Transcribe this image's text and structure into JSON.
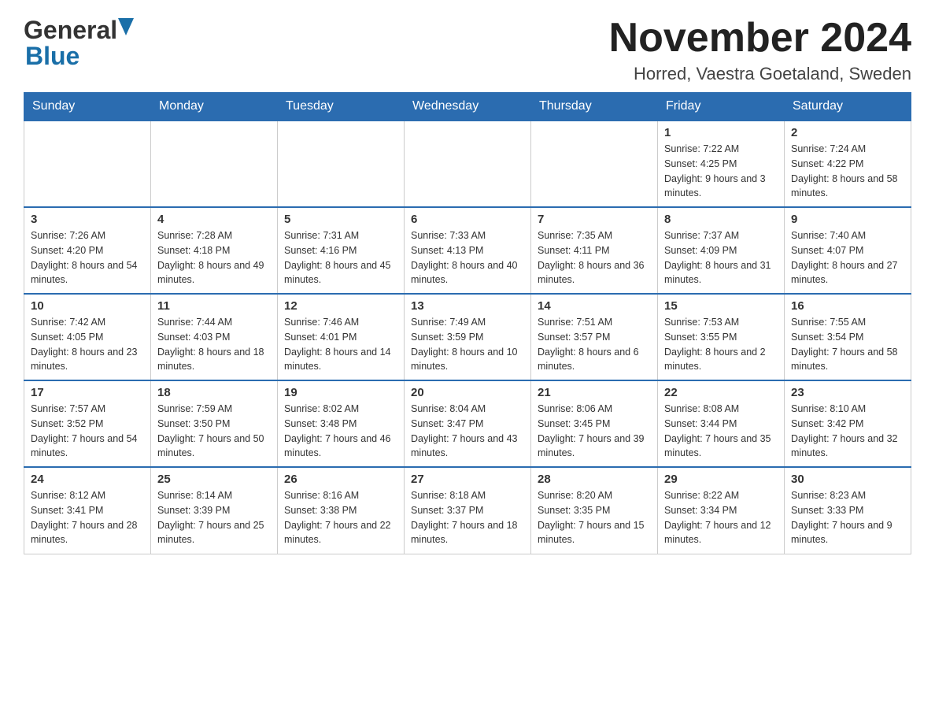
{
  "header": {
    "logo_general": "General",
    "logo_blue": "Blue",
    "month_title": "November 2024",
    "location": "Horred, Vaestra Goetaland, Sweden"
  },
  "calendar": {
    "days_of_week": [
      "Sunday",
      "Monday",
      "Tuesday",
      "Wednesday",
      "Thursday",
      "Friday",
      "Saturday"
    ],
    "weeks": [
      [
        {
          "day": "",
          "info": ""
        },
        {
          "day": "",
          "info": ""
        },
        {
          "day": "",
          "info": ""
        },
        {
          "day": "",
          "info": ""
        },
        {
          "day": "",
          "info": ""
        },
        {
          "day": "1",
          "info": "Sunrise: 7:22 AM\nSunset: 4:25 PM\nDaylight: 9 hours and 3 minutes."
        },
        {
          "day": "2",
          "info": "Sunrise: 7:24 AM\nSunset: 4:22 PM\nDaylight: 8 hours and 58 minutes."
        }
      ],
      [
        {
          "day": "3",
          "info": "Sunrise: 7:26 AM\nSunset: 4:20 PM\nDaylight: 8 hours and 54 minutes."
        },
        {
          "day": "4",
          "info": "Sunrise: 7:28 AM\nSunset: 4:18 PM\nDaylight: 8 hours and 49 minutes."
        },
        {
          "day": "5",
          "info": "Sunrise: 7:31 AM\nSunset: 4:16 PM\nDaylight: 8 hours and 45 minutes."
        },
        {
          "day": "6",
          "info": "Sunrise: 7:33 AM\nSunset: 4:13 PM\nDaylight: 8 hours and 40 minutes."
        },
        {
          "day": "7",
          "info": "Sunrise: 7:35 AM\nSunset: 4:11 PM\nDaylight: 8 hours and 36 minutes."
        },
        {
          "day": "8",
          "info": "Sunrise: 7:37 AM\nSunset: 4:09 PM\nDaylight: 8 hours and 31 minutes."
        },
        {
          "day": "9",
          "info": "Sunrise: 7:40 AM\nSunset: 4:07 PM\nDaylight: 8 hours and 27 minutes."
        }
      ],
      [
        {
          "day": "10",
          "info": "Sunrise: 7:42 AM\nSunset: 4:05 PM\nDaylight: 8 hours and 23 minutes."
        },
        {
          "day": "11",
          "info": "Sunrise: 7:44 AM\nSunset: 4:03 PM\nDaylight: 8 hours and 18 minutes."
        },
        {
          "day": "12",
          "info": "Sunrise: 7:46 AM\nSunset: 4:01 PM\nDaylight: 8 hours and 14 minutes."
        },
        {
          "day": "13",
          "info": "Sunrise: 7:49 AM\nSunset: 3:59 PM\nDaylight: 8 hours and 10 minutes."
        },
        {
          "day": "14",
          "info": "Sunrise: 7:51 AM\nSunset: 3:57 PM\nDaylight: 8 hours and 6 minutes."
        },
        {
          "day": "15",
          "info": "Sunrise: 7:53 AM\nSunset: 3:55 PM\nDaylight: 8 hours and 2 minutes."
        },
        {
          "day": "16",
          "info": "Sunrise: 7:55 AM\nSunset: 3:54 PM\nDaylight: 7 hours and 58 minutes."
        }
      ],
      [
        {
          "day": "17",
          "info": "Sunrise: 7:57 AM\nSunset: 3:52 PM\nDaylight: 7 hours and 54 minutes."
        },
        {
          "day": "18",
          "info": "Sunrise: 7:59 AM\nSunset: 3:50 PM\nDaylight: 7 hours and 50 minutes."
        },
        {
          "day": "19",
          "info": "Sunrise: 8:02 AM\nSunset: 3:48 PM\nDaylight: 7 hours and 46 minutes."
        },
        {
          "day": "20",
          "info": "Sunrise: 8:04 AM\nSunset: 3:47 PM\nDaylight: 7 hours and 43 minutes."
        },
        {
          "day": "21",
          "info": "Sunrise: 8:06 AM\nSunset: 3:45 PM\nDaylight: 7 hours and 39 minutes."
        },
        {
          "day": "22",
          "info": "Sunrise: 8:08 AM\nSunset: 3:44 PM\nDaylight: 7 hours and 35 minutes."
        },
        {
          "day": "23",
          "info": "Sunrise: 8:10 AM\nSunset: 3:42 PM\nDaylight: 7 hours and 32 minutes."
        }
      ],
      [
        {
          "day": "24",
          "info": "Sunrise: 8:12 AM\nSunset: 3:41 PM\nDaylight: 7 hours and 28 minutes."
        },
        {
          "day": "25",
          "info": "Sunrise: 8:14 AM\nSunset: 3:39 PM\nDaylight: 7 hours and 25 minutes."
        },
        {
          "day": "26",
          "info": "Sunrise: 8:16 AM\nSunset: 3:38 PM\nDaylight: 7 hours and 22 minutes."
        },
        {
          "day": "27",
          "info": "Sunrise: 8:18 AM\nSunset: 3:37 PM\nDaylight: 7 hours and 18 minutes."
        },
        {
          "day": "28",
          "info": "Sunrise: 8:20 AM\nSunset: 3:35 PM\nDaylight: 7 hours and 15 minutes."
        },
        {
          "day": "29",
          "info": "Sunrise: 8:22 AM\nSunset: 3:34 PM\nDaylight: 7 hours and 12 minutes."
        },
        {
          "day": "30",
          "info": "Sunrise: 8:23 AM\nSunset: 3:33 PM\nDaylight: 7 hours and 9 minutes."
        }
      ]
    ]
  }
}
